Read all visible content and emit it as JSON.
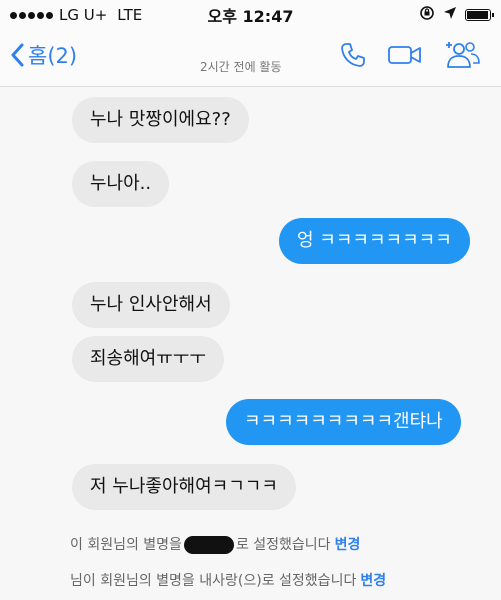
{
  "status_bar": {
    "carrier": "LG U+",
    "network": "LTE",
    "time": "오후 12:47"
  },
  "nav": {
    "back_label": "홈(2)",
    "presence": "2시간 전에 활동"
  },
  "messages": [
    {
      "direction": "in",
      "text": "누나 맛짱이에요??"
    },
    {
      "direction": "in",
      "text": "누나아.."
    },
    {
      "direction": "out",
      "text": "엉 ㅋㅋㅋㅋㅋㅋㅋㅋ"
    },
    {
      "direction": "in",
      "text": "누나 인사안해서"
    },
    {
      "direction": "in",
      "text": "죄송해여ㅠㅜㅜ"
    },
    {
      "direction": "out",
      "text": "ㅋㅋㅋㅋㅋㅋㅋㅋㅋ갠탸나"
    },
    {
      "direction": "in",
      "text": "저 누나좋아해여ㅋㄱㄱㅋ"
    }
  ],
  "notices": [
    {
      "prefix": "이 회원님의 별명을",
      "suffix": "로 설정했습니다",
      "link": "변경"
    },
    {
      "prefix": "님이 회원님의 별명을 내사랑(으)로 설정했습니다",
      "suffix": "",
      "link": "변경"
    }
  ],
  "colors": {
    "accent": "#2f80ed",
    "outgoing_bubble": "#2196f3",
    "incoming_bubble": "#e9e9ea"
  }
}
